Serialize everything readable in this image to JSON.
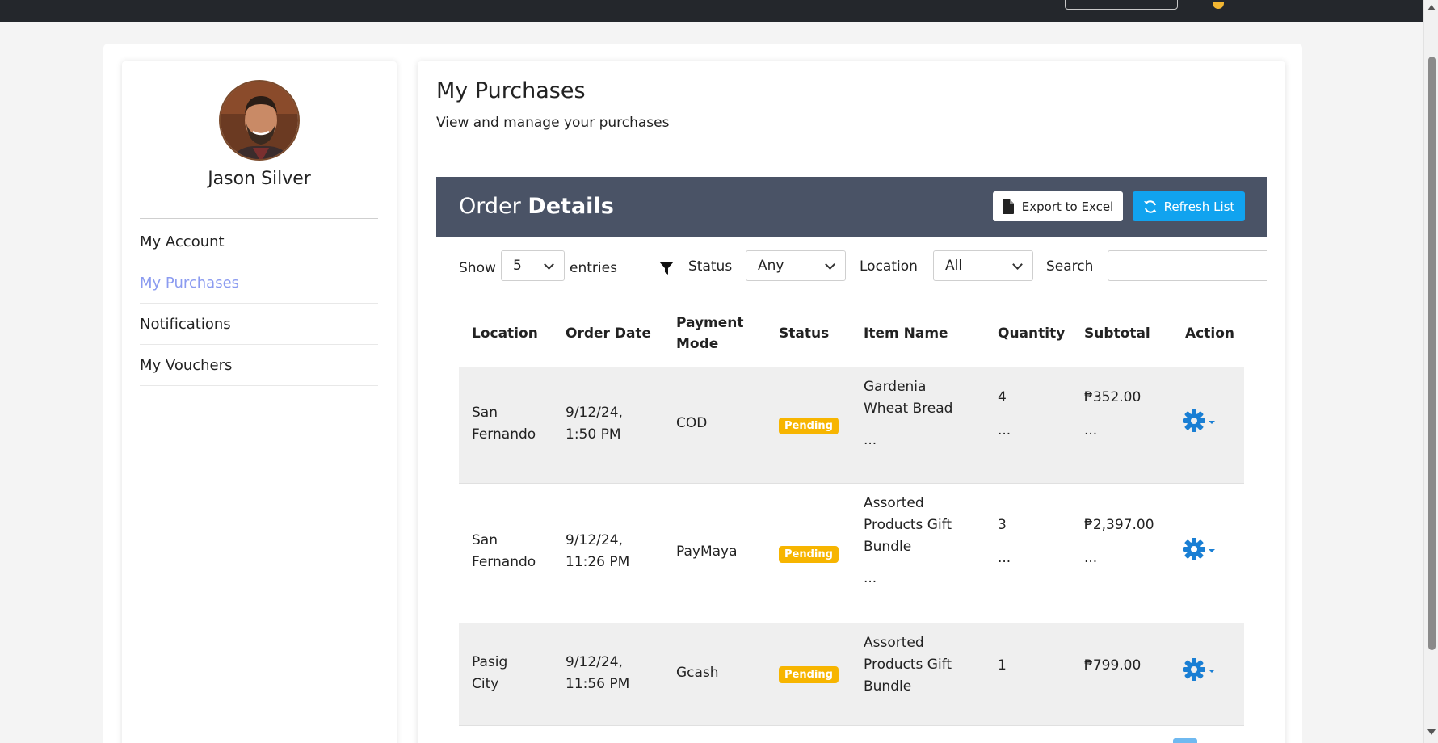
{
  "profile": {
    "name": "Jason Silver",
    "nav": [
      {
        "label": "My Account",
        "active": false
      },
      {
        "label": "My Purchases",
        "active": true
      },
      {
        "label": "Notifications",
        "active": false
      },
      {
        "label": "My Vouchers",
        "active": false
      }
    ]
  },
  "page": {
    "title": "My Purchases",
    "subtitle": "View and manage your purchases"
  },
  "order_panel": {
    "title_light": "Order",
    "title_bold": "Details",
    "export_label": "Export to Excel",
    "refresh_label": "Refresh List"
  },
  "filters": {
    "show_label": "Show",
    "entries_value": "5",
    "entries_label": "entries",
    "status_label": "Status",
    "status_value": "Any",
    "location_label": "Location",
    "location_value": "All",
    "search_label": "Search",
    "search_value": ""
  },
  "table": {
    "headers": {
      "location": "Location",
      "order_date": "Order Date",
      "payment_1": "Payment",
      "payment_2": "Mode",
      "status": "Status",
      "item_name": "Item Name",
      "quantity": "Quantity",
      "subtotal": "Subtotal",
      "action": "Action"
    },
    "rows": [
      {
        "loc_1": "San",
        "loc_2": "Fernando",
        "date_1": "9/12/24,",
        "date_2": "1:50 PM",
        "payment": "COD",
        "status": "Pending",
        "item_1": "Gardenia",
        "item_2": "Wheat Bread",
        "item_more": "...",
        "qty": "4",
        "qty_more": "...",
        "subtotal": "₱352.00",
        "subtotal_more": "..."
      },
      {
        "loc_1": "San",
        "loc_2": "Fernando",
        "date_1": "9/12/24,",
        "date_2": "11:26 PM",
        "payment": "PayMaya",
        "status": "Pending",
        "item_1": "Assorted",
        "item_2": "Products Gift",
        "item_3": "Bundle",
        "item_more": "...",
        "qty": "3",
        "qty_more": "...",
        "subtotal": "₱2,397.00",
        "subtotal_more": "..."
      },
      {
        "loc_1": "Pasig",
        "loc_2": "City",
        "date_1": "9/12/24,",
        "date_2": "11:56 PM",
        "payment": "Gcash",
        "status": "Pending",
        "item_1": "Assorted",
        "item_2": "Products Gift",
        "item_3": "Bundle",
        "qty": "1",
        "subtotal": "₱799.00"
      }
    ]
  },
  "colors": {
    "header_bg": "#4a5366",
    "refresh_bg": "#11a3ef",
    "badge_pending": "#f7b500",
    "gear": "#1a7fd4",
    "active_nav": "#8b9bf0"
  }
}
